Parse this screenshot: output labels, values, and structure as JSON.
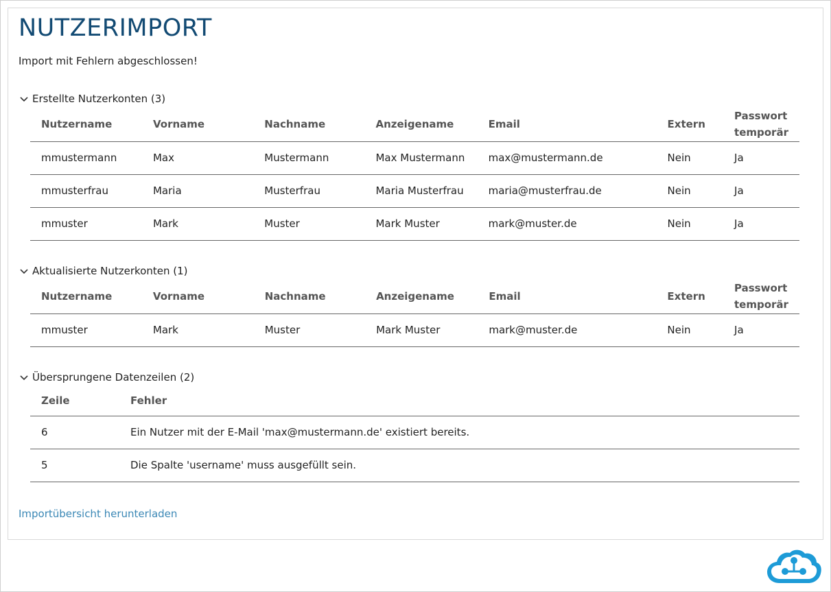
{
  "page": {
    "title": "NUTZERIMPORT",
    "status": "Import mit Fehlern abgeschlossen!",
    "download_link": "Importübersicht herunterladen"
  },
  "created": {
    "header": "Erstellte Nutzerkonten (3)",
    "columns": [
      "Nutzername",
      "Vorname",
      "Nachname",
      "Anzeigename",
      "Email",
      "Extern",
      "Passwort temporär"
    ],
    "rows": [
      [
        "mmustermann",
        "Max",
        "Mustermann",
        "Max Mustermann",
        "max@mustermann.de",
        "Nein",
        "Ja"
      ],
      [
        "mmusterfrau",
        "Maria",
        "Musterfrau",
        "Maria Musterfrau",
        "maria@musterfrau.de",
        "Nein",
        "Ja"
      ],
      [
        "mmuster",
        "Mark",
        "Muster",
        "Mark Muster",
        "mark@muster.de",
        "Nein",
        "Ja"
      ]
    ]
  },
  "updated": {
    "header": "Aktualisierte Nutzerkonten (1)",
    "columns": [
      "Nutzername",
      "Vorname",
      "Nachname",
      "Anzeigename",
      "Email",
      "Extern",
      "Passwort temporär"
    ],
    "rows": [
      [
        "mmuster",
        "Mark",
        "Muster",
        "Mark Muster",
        "mark@muster.de",
        "Nein",
        "Ja"
      ]
    ]
  },
  "skipped": {
    "header": "Übersprungene Datenzeilen (2)",
    "columns": [
      "Zeile",
      "Fehler"
    ],
    "rows": [
      [
        "6",
        "Ein Nutzer mit der E-Mail 'max@mustermann.de' existiert bereits."
      ],
      [
        "5",
        "Die Spalte 'username' muss ausgefüllt sein."
      ]
    ]
  },
  "icons": {
    "chevron": "chevron-down-icon",
    "logo": "cloud-logo-icon"
  },
  "colors": {
    "title": "#124a73",
    "link": "#3a87b5",
    "logo": "#1d9bd7"
  }
}
